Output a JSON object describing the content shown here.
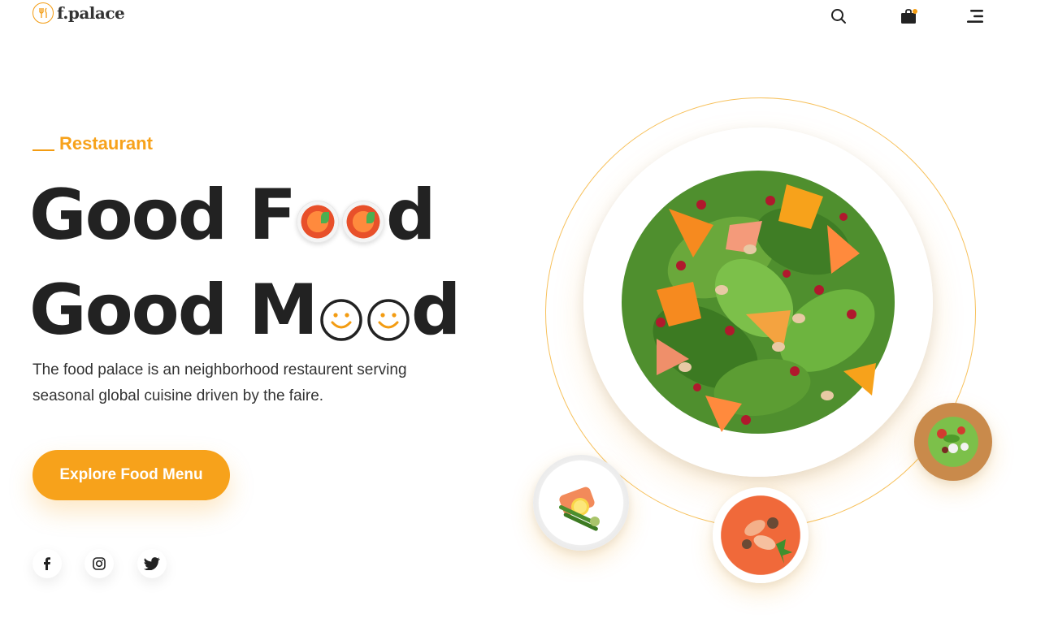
{
  "brand": {
    "name": "f.palace",
    "logo_icon": "fork-knife-logo-icon",
    "accent_color": "#f7a21b"
  },
  "header": {
    "icons": [
      "search-icon",
      "shopping-bag-icon",
      "menu-icon"
    ],
    "cart_has_items": true
  },
  "hero": {
    "eyebrow": "Restaurant",
    "headline_line1": {
      "before": "Good F",
      "after": "d"
    },
    "headline_line2": {
      "before": "Good M",
      "after": "d"
    },
    "description": "The food palace is an neighborhood restaurent serving seasonal global cuisine driven by the faire.",
    "cta_label": "Explore Food Menu"
  },
  "social": [
    "facebook-icon",
    "instagram-icon",
    "twitter-icon"
  ],
  "images": {
    "main": "salad-plate",
    "side": [
      "salmon-plate",
      "seafood-soup-bowl",
      "salad-bowl"
    ]
  }
}
